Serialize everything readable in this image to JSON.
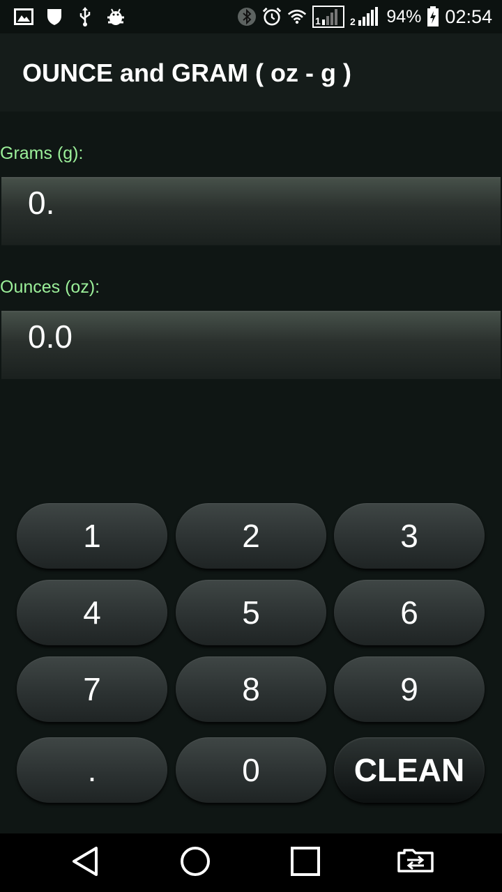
{
  "status_bar": {
    "battery_percent": "94%",
    "time": "02:54",
    "sim1_label": "1",
    "sim2_label": "2",
    "left_icons": [
      "image-icon",
      "shield-icon",
      "usb-icon",
      "android-debug-icon"
    ],
    "right_icons": [
      "bluetooth-icon",
      "alarm-icon",
      "wifi-icon",
      "signal-sim1-icon",
      "signal-sim2-icon",
      "battery-charging-icon"
    ]
  },
  "app_bar": {
    "title": "OUNCE and GRAM ( oz - g )"
  },
  "grams": {
    "label": "Grams (g):",
    "value": "0."
  },
  "ounces": {
    "label": "Ounces (oz):",
    "value": "0.0"
  },
  "keypad": {
    "keys": [
      "1",
      "2",
      "3",
      "4",
      "5",
      "6",
      "7",
      "8",
      "9",
      ".",
      "0",
      "CLEAN"
    ]
  },
  "nav_bar": {
    "icons": [
      "back-icon",
      "home-icon",
      "recents-icon",
      "sim-switch-icon"
    ]
  },
  "colors": {
    "background": "#0f1614",
    "app_bar": "#151c1a",
    "label_green": "#9cf09a",
    "text": "#ffffff"
  }
}
